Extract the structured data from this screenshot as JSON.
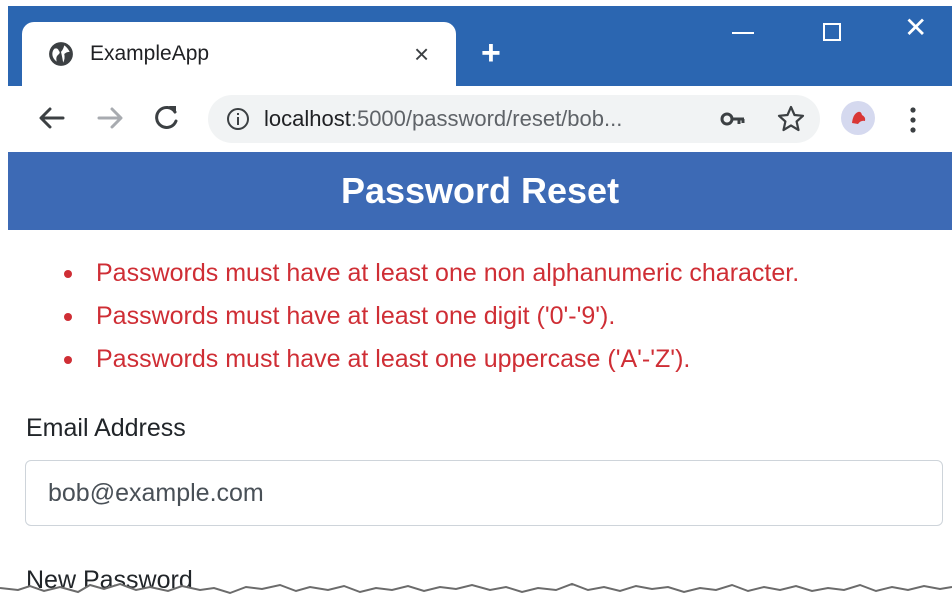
{
  "browser": {
    "tab_title": "ExampleApp",
    "tab_close": "×",
    "new_tab": "+",
    "window_close": "✕",
    "url_host": "localhost",
    "url_rest": ":5000/password/reset/bob...",
    "icons": {
      "tab": "globe-icon",
      "back": "arrow-left-icon",
      "forward": "arrow-right-icon",
      "reload": "reload-icon",
      "info": "info-icon",
      "password": "key-icon",
      "bookmark": "star-icon",
      "profile": "avatar",
      "menu": "kebab-menu-icon"
    }
  },
  "page": {
    "header_title": "Password Reset",
    "errors": [
      "Passwords must have at least one non alphanumeric character.",
      "Passwords must have at least one digit ('0'-'9').",
      "Passwords must have at least one uppercase ('A'-'Z')."
    ],
    "email_label": "Email Address",
    "email_value": "bob@example.com",
    "password_label": "New Password"
  },
  "colors": {
    "titlebar": "#2b66b1",
    "header": "#3d6ab5",
    "error_text": "#cf2e35"
  }
}
